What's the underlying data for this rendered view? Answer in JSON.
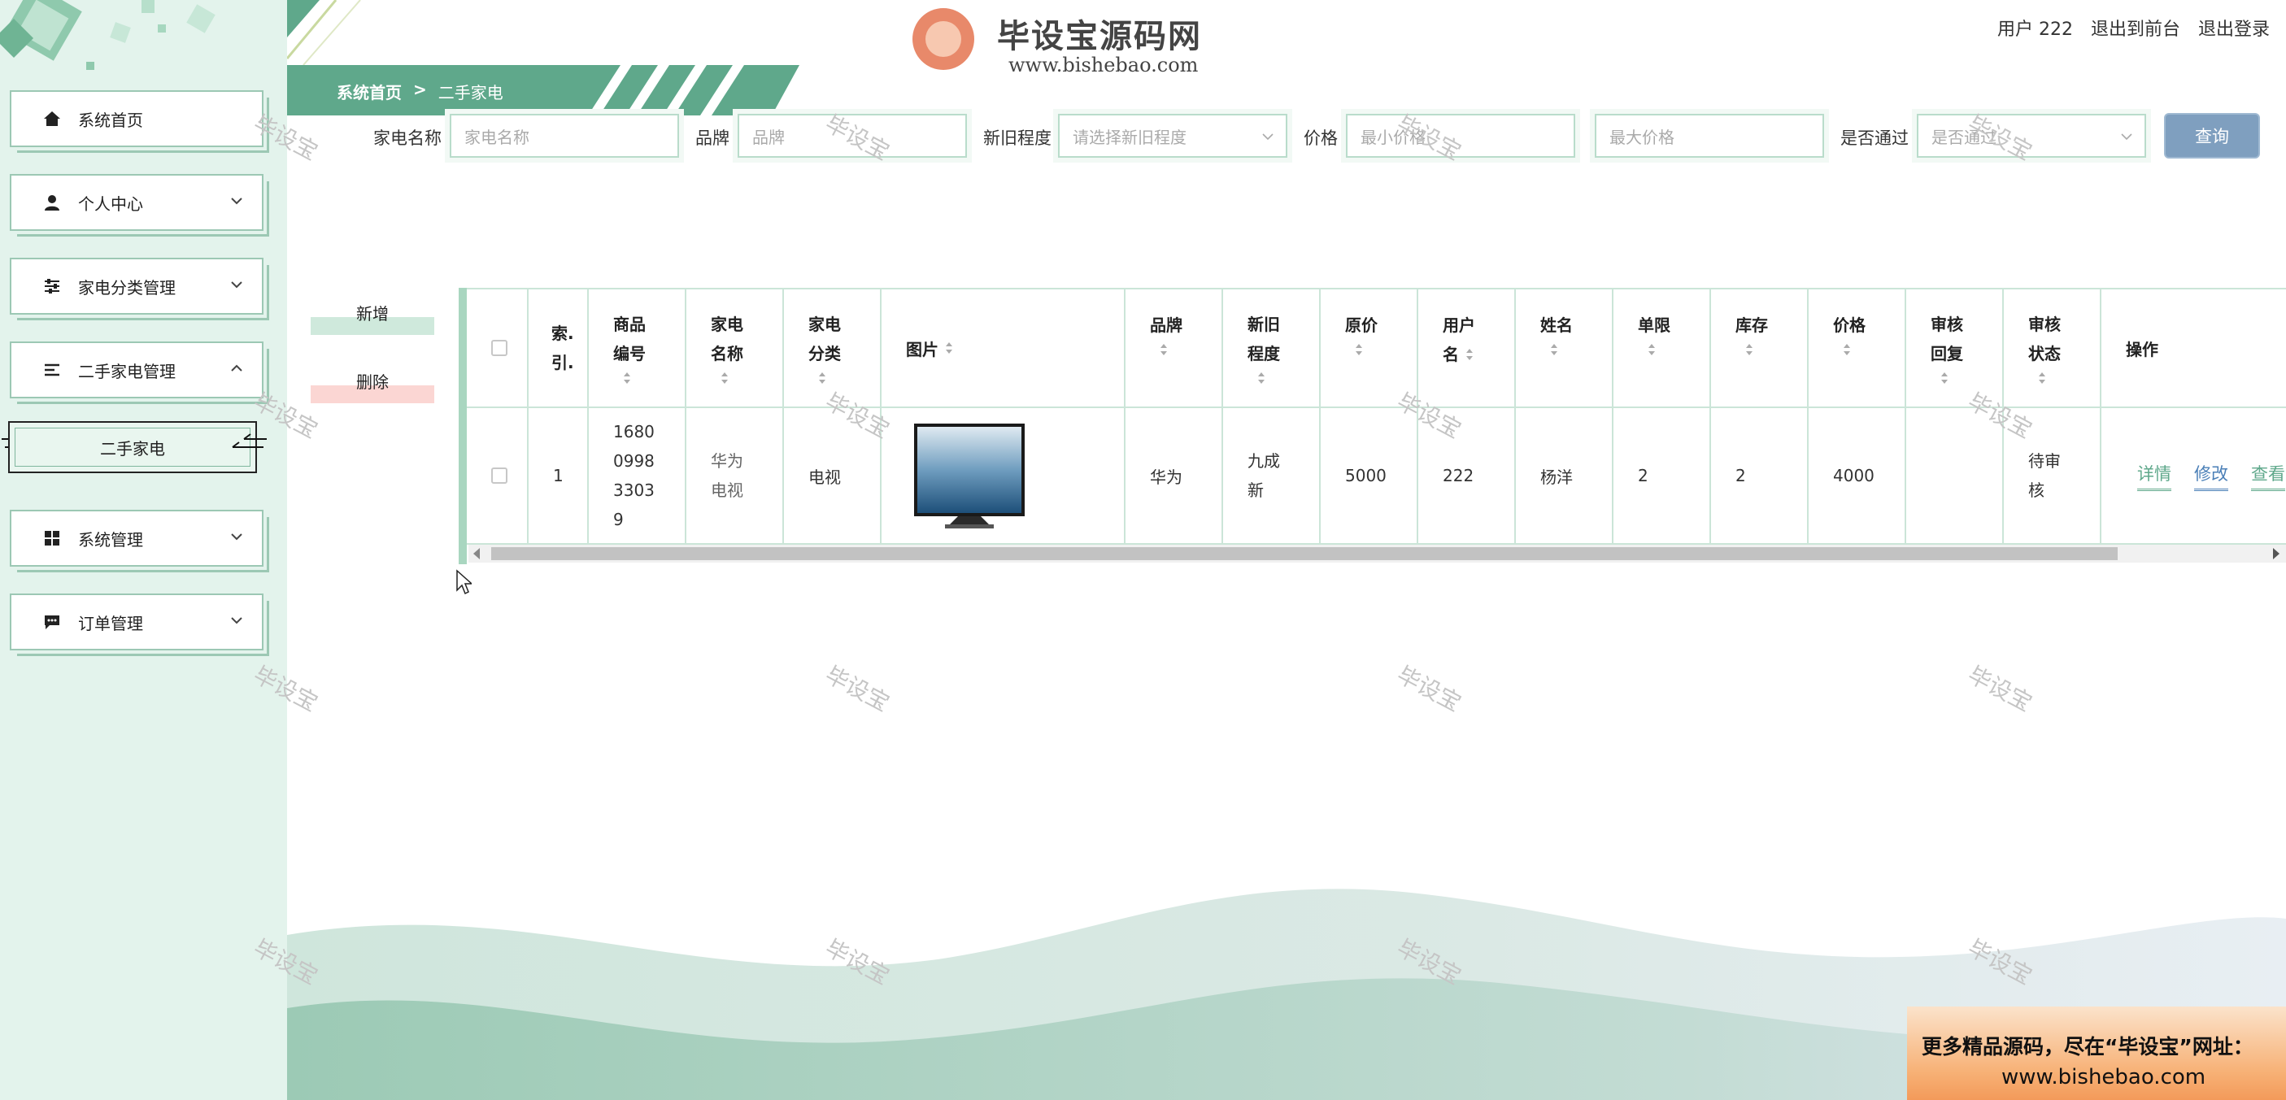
{
  "header": {
    "user_label": "用户 222",
    "to_front": "退出到前台",
    "logout": "退出登录",
    "logo_text": "毕设宝源码网",
    "logo_url": "www.bishebao.com"
  },
  "breadcrumb": {
    "home": "系统首页",
    "sep": ">",
    "current": "二手家电"
  },
  "sidebar": {
    "items": [
      {
        "label": "系统首页",
        "icon": "home-icon"
      },
      {
        "label": "个人中心",
        "icon": "user-icon"
      },
      {
        "label": "家电分类管理",
        "icon": "sliders-icon"
      },
      {
        "label": "二手家电管理",
        "icon": "list-icon",
        "expanded": true
      },
      {
        "label": "系统管理",
        "icon": "grid-icon"
      },
      {
        "label": "订单管理",
        "icon": "chat-icon"
      }
    ],
    "submenu": {
      "label": "二手家电"
    }
  },
  "search": {
    "name_label": "家电名称",
    "name_placeholder": "家电名称",
    "brand_label": "品牌",
    "brand_placeholder": "品牌",
    "condition_label": "新旧程度",
    "condition_placeholder": "请选择新旧程度",
    "price_label": "价格",
    "min_placeholder": "最小价格",
    "max_placeholder": "最大价格",
    "approved_label": "是否通过",
    "approved_placeholder": "是否通过",
    "query_button": "查询"
  },
  "actions": {
    "add": "新增",
    "delete": "删除"
  },
  "table": {
    "headers": {
      "index_a": "索.",
      "index_b": "引.",
      "code_a": "商品",
      "code_b": "编号",
      "name_a": "家电",
      "name_b": "名称",
      "cat_a": "家电",
      "cat_b": "分类",
      "image": "图片",
      "brand": "品牌",
      "cond_a": "新旧",
      "cond_b": "程度",
      "orig": "原价",
      "user_a": "用户",
      "user_b": "名",
      "realname": "姓名",
      "limit": "单限",
      "stock": "库存",
      "price": "价格",
      "reply_a": "审核",
      "reply_b": "回复",
      "status_a": "审核",
      "status_b": "状态",
      "ops": "操作"
    },
    "row": {
      "index": "1",
      "code_1": "1680",
      "code_2": "0998",
      "code_3": "3303",
      "code_4": "9",
      "name_1": "华为",
      "name_2": "电视",
      "category": "电视",
      "brand": "华为",
      "cond_1": "九成",
      "cond_2": "新",
      "orig_price": "5000",
      "username": "222",
      "realname": "杨洋",
      "limit": "2",
      "stock": "2",
      "price": "4000",
      "reply": "",
      "status_1": "待审",
      "status_2": "核",
      "op_detail": "详情",
      "op_edit": "修改",
      "op_view": "查看"
    }
  },
  "watermark": "毕设宝",
  "promo": {
    "line1": "更多精品源码，尽在“毕设宝”网址：",
    "line2": "www.bishebao.com"
  },
  "colors": {
    "primary": "#5fa88b",
    "sidebar_bg": "#e3f3ec",
    "query_btn": "#7f9fbf",
    "edit_link": "#4a7fb7"
  }
}
